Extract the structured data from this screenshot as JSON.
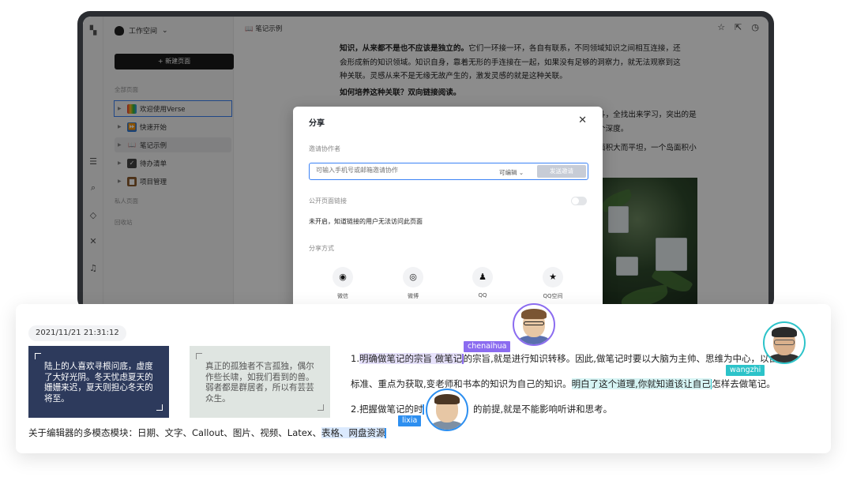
{
  "app": {
    "workspace": "工作空间",
    "new_page": "+ 新建页面",
    "sections": {
      "all_pages": "全部页面",
      "private_pages": "私人页面",
      "trash": "回收站"
    },
    "tree": [
      {
        "label": "欢迎使用Verse",
        "icon": "rainbow-icon"
      },
      {
        "label": "快速开始",
        "icon": "play-icon"
      },
      {
        "label": "笔记示例",
        "icon": "book-icon"
      },
      {
        "label": "待办清单",
        "icon": "checkbox-icon"
      },
      {
        "label": "项目管理",
        "icon": "briefcase-icon"
      }
    ],
    "breadcrumb": "笔记示例",
    "doc": {
      "p1_bold": "知识，从来都不是也不应该是独立的。",
      "p1_rest_l1": "它们一环接一环，各自有联系，不同领域知识之间相互连接，还",
      "p1_l2": "会形成新的知识领域。知识自身，靠着无形的手连接在一起，如果没有足够的洞察力，就无法观察到这",
      "p1_l3": "种关联。灵感从来不是无缘无故产生的，激发灵感的就是这种关联。",
      "p2_bold": "如何培养这种关联？双向链接阅读。",
      "frag1": "斗，全找出来学习，突出的是",
      "frag2": "个深度。",
      "frag3": "面积大而平坦，一个岛面积小"
    }
  },
  "share_modal": {
    "title": "分享",
    "invite_label": "邀请协作者",
    "invite_placeholder": "可输入手机号或邮箱邀请协作",
    "permission": "可编辑 ⌄",
    "send_button": "发送邀请",
    "public_link_label": "公开页面链接",
    "public_link_status": "未开启，知道链接的用户无法访问此页面",
    "share_method_label": "分享方式",
    "methods": [
      {
        "label": "微信",
        "icon": "wechat-icon"
      },
      {
        "label": "微博",
        "icon": "weibo-icon"
      },
      {
        "label": "QQ",
        "icon": "qq-icon"
      },
      {
        "label": "QQ空间",
        "icon": "qzone-icon"
      }
    ]
  },
  "editor": {
    "date": "2021/11/21 21:31:12",
    "callout_dark": "陆上的人喜欢寻根问底，虚度了大好光阴。冬天忧虑夏天的姗姗来迟，夏天则担心冬天的将至。",
    "callout_light": "真正的孤独者不言孤独，偶尔作些长啸，如我们看到的兽。弱者都是群居者，所以有芸芸众生。",
    "line1": {
      "prefix": "1.",
      "hl": "明确做笔记的宗旨 做笔记",
      "rest": "的宗旨,就是进行知识转移。因此,做笔记时要以大脑为主帅、思维为中心，以目"
    },
    "line2": {
      "pre": "标准、重点为获取,变老师和书本的知识为自己的知识。",
      "hl": "明白了这个道理,你就知道该让自己",
      "post": "怎样去做笔记。"
    },
    "line3": {
      "pre": "2.把握做笔记的时",
      "post": "的前提,就是不能影响听讲和思考。"
    },
    "modules_pre": "关于编辑器的多模态模块：日期、文字、Callout、图片、视频、Latex、",
    "modules_hl": "表格、网盘资源",
    "collaborators": [
      {
        "name": "chenaihua",
        "color": "#8b6cf0"
      },
      {
        "name": "wangzhi",
        "color": "#2cc3c9"
      },
      {
        "name": "lixia",
        "color": "#2d8ff0"
      }
    ]
  }
}
